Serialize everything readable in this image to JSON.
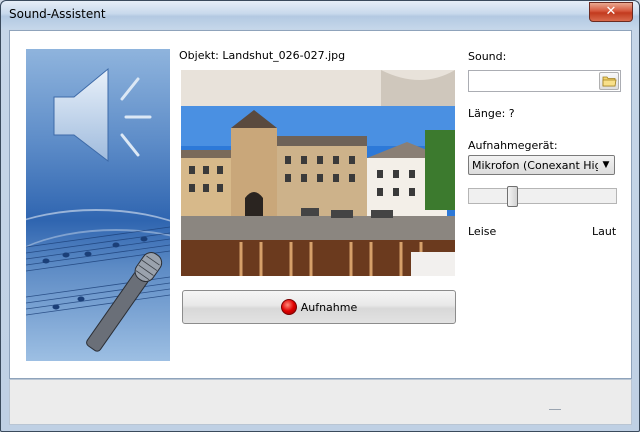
{
  "window": {
    "title": "Sound-Assistent",
    "close_label": "✕"
  },
  "object": {
    "label": "Objekt: Landshut_026-027.jpg"
  },
  "record_button": {
    "label": "Aufnahme"
  },
  "sound": {
    "label": "Sound:",
    "value": ""
  },
  "length": {
    "label": "Länge: ?"
  },
  "device": {
    "label": "Aufnahmegerät:",
    "selected": "Mikrofon (Conexant High"
  },
  "volume": {
    "min_label": "Leise",
    "max_label": "Laut",
    "level": 0.28
  },
  "icons": {
    "folder": "folder-icon",
    "record": "record-icon",
    "speaker": "speaker-icon",
    "microphone": "microphone-icon",
    "dropdown": "chevron-down-icon"
  }
}
